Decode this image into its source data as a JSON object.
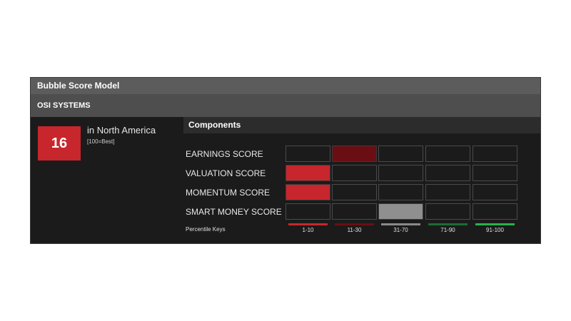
{
  "model_title": "Bubble Score Model",
  "company": "OSI SYSTEMS",
  "score": {
    "value": "16",
    "region": "in North America",
    "note": "[100=Best]"
  },
  "components": {
    "title": "Components",
    "rows": [
      {
        "label": "EARNINGS SCORE",
        "active_bucket": 1
      },
      {
        "label": "VALUATION SCORE",
        "active_bucket": 0
      },
      {
        "label": "MOMENTUM SCORE",
        "active_bucket": 0
      },
      {
        "label": "SMART MONEY SCORE",
        "active_bucket": 2
      }
    ]
  },
  "percentile_keys": {
    "label": "Percentile Keys",
    "keys": [
      {
        "label": "1-10",
        "color": "#c8262d",
        "fill": "#c8262d"
      },
      {
        "label": "11-30",
        "color": "#6a0e14",
        "fill": "#6a0e14"
      },
      {
        "label": "31-70",
        "color": "#8a8a8a",
        "fill": "#8f8f8f"
      },
      {
        "label": "71-90",
        "color": "#1f6a35",
        "fill": "#1f6a35"
      },
      {
        "label": "91-100",
        "color": "#2bb04b",
        "fill": "#2bb04b"
      }
    ]
  }
}
